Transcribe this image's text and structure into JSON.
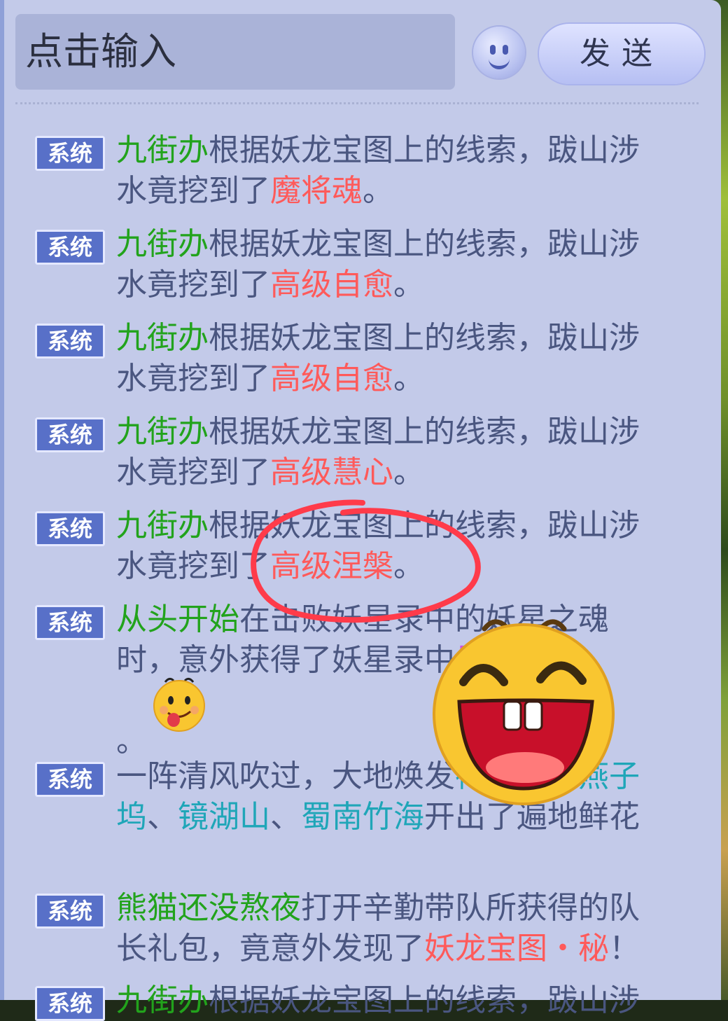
{
  "input": {
    "placeholder": "点击输入"
  },
  "send_button": {
    "label": "发送"
  },
  "messages": [
    {
      "badge": "系统",
      "name": "九街办",
      "text1": "根据妖龙宝图上的线索，跋山涉水竟挖到了",
      "item": "魔将魂",
      "text2": "。"
    },
    {
      "badge": "系统",
      "name": "九街办",
      "text1": "根据妖龙宝图上的线索，跋山涉水竟挖到了",
      "item": "高级自愈",
      "text2": "。"
    },
    {
      "badge": "系统",
      "name": "九街办",
      "text1": "根据妖龙宝图上的线索，跋山涉水竟挖到了",
      "item": "高级自愈",
      "text2": "。"
    },
    {
      "badge": "系统",
      "name": "九街办",
      "text1": "根据妖龙宝图上的线索，跋山涉水竟挖到了",
      "item": "高级慧心",
      "text2": "。"
    },
    {
      "badge": "系统",
      "name": "九街办",
      "text1": "根据妖龙宝图上的线索，跋山涉水竟挖到了",
      "item": "高级涅槃",
      "text2": "。"
    },
    {
      "badge": "系统",
      "name": "从头开始",
      "text1": "在击败妖星录中的妖星之魂时，意外获得了妖星录中",
      "item": "星魂",
      "text2": "。"
    },
    {
      "badge": "系统",
      "text1": "一阵清风吹过，大地焕发",
      "place1": "神木林",
      "sep1": "、",
      "place2": "燕子坞",
      "sep2": "、",
      "place3": "镜湖山",
      "sep3": "、",
      "place4": "蜀南竹海",
      "text2": "开出了遍地鲜花"
    },
    {
      "badge": "系统",
      "name": "熊猫还没熬夜",
      "text1": "打开辛勤带队所获得的队长礼包，竟意外发现了",
      "item": "妖龙宝图・秘",
      "text2": "！"
    },
    {
      "badge": "系统",
      "name": "九街办",
      "text1": "根据妖龙宝图上的线索，跋山涉"
    }
  ],
  "colors": {
    "player_name": "#22a31c",
    "item": "#ff5a5a",
    "place": "#1fa6b8",
    "badge": "#5870c8",
    "panel": "#c3cae9"
  }
}
